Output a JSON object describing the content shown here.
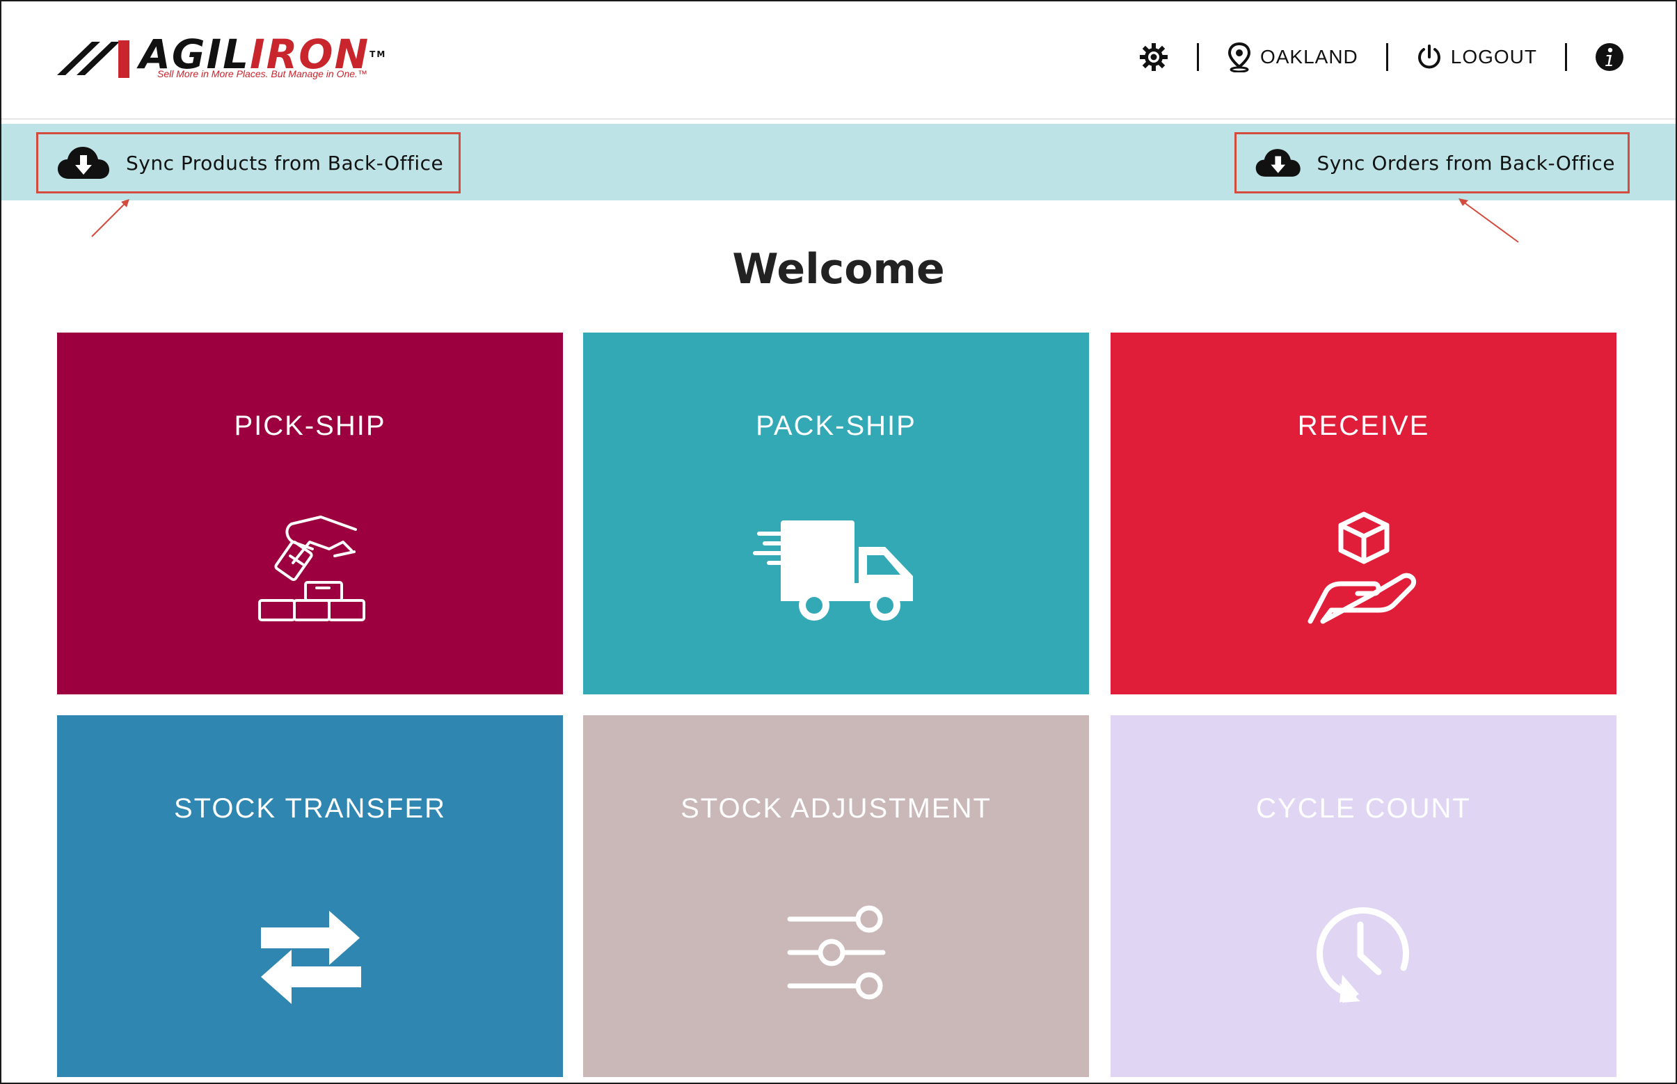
{
  "header": {
    "logo_word_a": "AGIL",
    "logo_word_b": "IRON",
    "logo_tm": "TM",
    "logo_tagline": "Sell More in More Places. But Manage in One.™",
    "location_label": "OAKLAND",
    "logout_label": "LOGOUT",
    "icons": [
      "gear-icon",
      "location-pin-icon",
      "power-icon",
      "info-icon"
    ]
  },
  "sync_bar": {
    "products_label": "Sync Products from Back-Office",
    "orders_label": "Sync Orders from Back-Office",
    "background": "#bde3e6",
    "highlight_color": "#d24b3c"
  },
  "main": {
    "welcome": "Welcome",
    "tiles": [
      {
        "label": "PICK-SHIP",
        "color": "#9d003f",
        "icon": "pick-hand-icon"
      },
      {
        "label": "PACK-SHIP",
        "color": "#33a9b6",
        "icon": "truck-icon"
      },
      {
        "label": "RECEIVE",
        "color": "#e01e3a",
        "icon": "hand-box-icon"
      },
      {
        "label": "STOCK TRANSFER",
        "color": "#2e86b1",
        "icon": "transfer-arrows-icon"
      },
      {
        "label": "STOCK ADJUSTMENT",
        "color": "#cab8b8",
        "icon": "sliders-icon"
      },
      {
        "label": "CYCLE COUNT",
        "color": "#e0d6f4",
        "icon": "clock-history-icon"
      }
    ]
  }
}
